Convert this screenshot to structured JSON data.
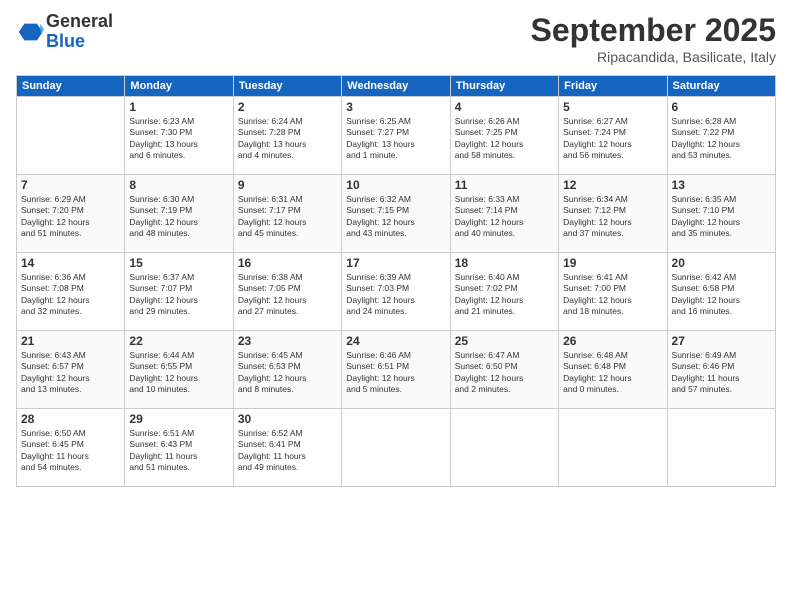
{
  "header": {
    "logo_general": "General",
    "logo_blue": "Blue",
    "month": "September 2025",
    "location": "Ripacandida, Basilicate, Italy"
  },
  "weekdays": [
    "Sunday",
    "Monday",
    "Tuesday",
    "Wednesday",
    "Thursday",
    "Friday",
    "Saturday"
  ],
  "weeks": [
    [
      {
        "day": "",
        "info": ""
      },
      {
        "day": "1",
        "info": "Sunrise: 6:23 AM\nSunset: 7:30 PM\nDaylight: 13 hours\nand 6 minutes."
      },
      {
        "day": "2",
        "info": "Sunrise: 6:24 AM\nSunset: 7:28 PM\nDaylight: 13 hours\nand 4 minutes."
      },
      {
        "day": "3",
        "info": "Sunrise: 6:25 AM\nSunset: 7:27 PM\nDaylight: 13 hours\nand 1 minute."
      },
      {
        "day": "4",
        "info": "Sunrise: 6:26 AM\nSunset: 7:25 PM\nDaylight: 12 hours\nand 58 minutes."
      },
      {
        "day": "5",
        "info": "Sunrise: 6:27 AM\nSunset: 7:24 PM\nDaylight: 12 hours\nand 56 minutes."
      },
      {
        "day": "6",
        "info": "Sunrise: 6:28 AM\nSunset: 7:22 PM\nDaylight: 12 hours\nand 53 minutes."
      }
    ],
    [
      {
        "day": "7",
        "info": "Sunrise: 6:29 AM\nSunset: 7:20 PM\nDaylight: 12 hours\nand 51 minutes."
      },
      {
        "day": "8",
        "info": "Sunrise: 6:30 AM\nSunset: 7:19 PM\nDaylight: 12 hours\nand 48 minutes."
      },
      {
        "day": "9",
        "info": "Sunrise: 6:31 AM\nSunset: 7:17 PM\nDaylight: 12 hours\nand 45 minutes."
      },
      {
        "day": "10",
        "info": "Sunrise: 6:32 AM\nSunset: 7:15 PM\nDaylight: 12 hours\nand 43 minutes."
      },
      {
        "day": "11",
        "info": "Sunrise: 6:33 AM\nSunset: 7:14 PM\nDaylight: 12 hours\nand 40 minutes."
      },
      {
        "day": "12",
        "info": "Sunrise: 6:34 AM\nSunset: 7:12 PM\nDaylight: 12 hours\nand 37 minutes."
      },
      {
        "day": "13",
        "info": "Sunrise: 6:35 AM\nSunset: 7:10 PM\nDaylight: 12 hours\nand 35 minutes."
      }
    ],
    [
      {
        "day": "14",
        "info": "Sunrise: 6:36 AM\nSunset: 7:08 PM\nDaylight: 12 hours\nand 32 minutes."
      },
      {
        "day": "15",
        "info": "Sunrise: 6:37 AM\nSunset: 7:07 PM\nDaylight: 12 hours\nand 29 minutes."
      },
      {
        "day": "16",
        "info": "Sunrise: 6:38 AM\nSunset: 7:05 PM\nDaylight: 12 hours\nand 27 minutes."
      },
      {
        "day": "17",
        "info": "Sunrise: 6:39 AM\nSunset: 7:03 PM\nDaylight: 12 hours\nand 24 minutes."
      },
      {
        "day": "18",
        "info": "Sunrise: 6:40 AM\nSunset: 7:02 PM\nDaylight: 12 hours\nand 21 minutes."
      },
      {
        "day": "19",
        "info": "Sunrise: 6:41 AM\nSunset: 7:00 PM\nDaylight: 12 hours\nand 18 minutes."
      },
      {
        "day": "20",
        "info": "Sunrise: 6:42 AM\nSunset: 6:58 PM\nDaylight: 12 hours\nand 16 minutes."
      }
    ],
    [
      {
        "day": "21",
        "info": "Sunrise: 6:43 AM\nSunset: 6:57 PM\nDaylight: 12 hours\nand 13 minutes."
      },
      {
        "day": "22",
        "info": "Sunrise: 6:44 AM\nSunset: 6:55 PM\nDaylight: 12 hours\nand 10 minutes."
      },
      {
        "day": "23",
        "info": "Sunrise: 6:45 AM\nSunset: 6:53 PM\nDaylight: 12 hours\nand 8 minutes."
      },
      {
        "day": "24",
        "info": "Sunrise: 6:46 AM\nSunset: 6:51 PM\nDaylight: 12 hours\nand 5 minutes."
      },
      {
        "day": "25",
        "info": "Sunrise: 6:47 AM\nSunset: 6:50 PM\nDaylight: 12 hours\nand 2 minutes."
      },
      {
        "day": "26",
        "info": "Sunrise: 6:48 AM\nSunset: 6:48 PM\nDaylight: 12 hours\nand 0 minutes."
      },
      {
        "day": "27",
        "info": "Sunrise: 6:49 AM\nSunset: 6:46 PM\nDaylight: 11 hours\nand 57 minutes."
      }
    ],
    [
      {
        "day": "28",
        "info": "Sunrise: 6:50 AM\nSunset: 6:45 PM\nDaylight: 11 hours\nand 54 minutes."
      },
      {
        "day": "29",
        "info": "Sunrise: 6:51 AM\nSunset: 6:43 PM\nDaylight: 11 hours\nand 51 minutes."
      },
      {
        "day": "30",
        "info": "Sunrise: 6:52 AM\nSunset: 6:41 PM\nDaylight: 11 hours\nand 49 minutes."
      },
      {
        "day": "",
        "info": ""
      },
      {
        "day": "",
        "info": ""
      },
      {
        "day": "",
        "info": ""
      },
      {
        "day": "",
        "info": ""
      }
    ]
  ]
}
